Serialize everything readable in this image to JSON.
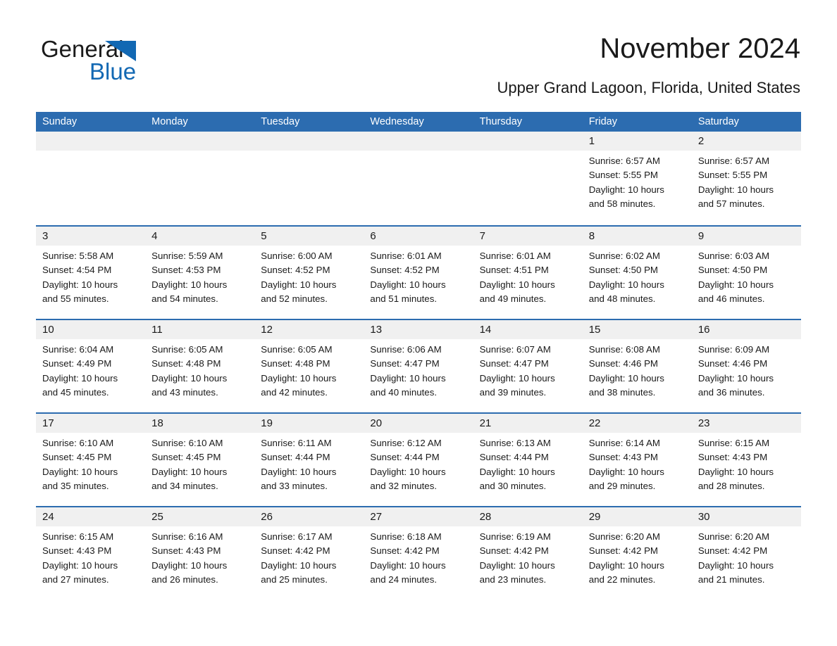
{
  "brand": {
    "name_part1": "General",
    "name_part2": "Blue",
    "triangle_color": "#1268b3",
    "accent_color": "#2c6cb0"
  },
  "header": {
    "title": "November 2024",
    "subtitle": "Upper Grand Lagoon, Florida, United States"
  },
  "calendar": {
    "weekdays": [
      "Sunday",
      "Monday",
      "Tuesday",
      "Wednesday",
      "Thursday",
      "Friday",
      "Saturday"
    ],
    "header_bg": "#2c6cb0",
    "daynum_bg": "#f0f0f0",
    "weeks": [
      [
        {
          "day": "",
          "sunrise": "",
          "sunset": "",
          "daylight1": "",
          "daylight2": ""
        },
        {
          "day": "",
          "sunrise": "",
          "sunset": "",
          "daylight1": "",
          "daylight2": ""
        },
        {
          "day": "",
          "sunrise": "",
          "sunset": "",
          "daylight1": "",
          "daylight2": ""
        },
        {
          "day": "",
          "sunrise": "",
          "sunset": "",
          "daylight1": "",
          "daylight2": ""
        },
        {
          "day": "",
          "sunrise": "",
          "sunset": "",
          "daylight1": "",
          "daylight2": ""
        },
        {
          "day": "1",
          "sunrise": "Sunrise: 6:57 AM",
          "sunset": "Sunset: 5:55 PM",
          "daylight1": "Daylight: 10 hours",
          "daylight2": "and 58 minutes."
        },
        {
          "day": "2",
          "sunrise": "Sunrise: 6:57 AM",
          "sunset": "Sunset: 5:55 PM",
          "daylight1": "Daylight: 10 hours",
          "daylight2": "and 57 minutes."
        }
      ],
      [
        {
          "day": "3",
          "sunrise": "Sunrise: 5:58 AM",
          "sunset": "Sunset: 4:54 PM",
          "daylight1": "Daylight: 10 hours",
          "daylight2": "and 55 minutes."
        },
        {
          "day": "4",
          "sunrise": "Sunrise: 5:59 AM",
          "sunset": "Sunset: 4:53 PM",
          "daylight1": "Daylight: 10 hours",
          "daylight2": "and 54 minutes."
        },
        {
          "day": "5",
          "sunrise": "Sunrise: 6:00 AM",
          "sunset": "Sunset: 4:52 PM",
          "daylight1": "Daylight: 10 hours",
          "daylight2": "and 52 minutes."
        },
        {
          "day": "6",
          "sunrise": "Sunrise: 6:01 AM",
          "sunset": "Sunset: 4:52 PM",
          "daylight1": "Daylight: 10 hours",
          "daylight2": "and 51 minutes."
        },
        {
          "day": "7",
          "sunrise": "Sunrise: 6:01 AM",
          "sunset": "Sunset: 4:51 PM",
          "daylight1": "Daylight: 10 hours",
          "daylight2": "and 49 minutes."
        },
        {
          "day": "8",
          "sunrise": "Sunrise: 6:02 AM",
          "sunset": "Sunset: 4:50 PM",
          "daylight1": "Daylight: 10 hours",
          "daylight2": "and 48 minutes."
        },
        {
          "day": "9",
          "sunrise": "Sunrise: 6:03 AM",
          "sunset": "Sunset: 4:50 PM",
          "daylight1": "Daylight: 10 hours",
          "daylight2": "and 46 minutes."
        }
      ],
      [
        {
          "day": "10",
          "sunrise": "Sunrise: 6:04 AM",
          "sunset": "Sunset: 4:49 PM",
          "daylight1": "Daylight: 10 hours",
          "daylight2": "and 45 minutes."
        },
        {
          "day": "11",
          "sunrise": "Sunrise: 6:05 AM",
          "sunset": "Sunset: 4:48 PM",
          "daylight1": "Daylight: 10 hours",
          "daylight2": "and 43 minutes."
        },
        {
          "day": "12",
          "sunrise": "Sunrise: 6:05 AM",
          "sunset": "Sunset: 4:48 PM",
          "daylight1": "Daylight: 10 hours",
          "daylight2": "and 42 minutes."
        },
        {
          "day": "13",
          "sunrise": "Sunrise: 6:06 AM",
          "sunset": "Sunset: 4:47 PM",
          "daylight1": "Daylight: 10 hours",
          "daylight2": "and 40 minutes."
        },
        {
          "day": "14",
          "sunrise": "Sunrise: 6:07 AM",
          "sunset": "Sunset: 4:47 PM",
          "daylight1": "Daylight: 10 hours",
          "daylight2": "and 39 minutes."
        },
        {
          "day": "15",
          "sunrise": "Sunrise: 6:08 AM",
          "sunset": "Sunset: 4:46 PM",
          "daylight1": "Daylight: 10 hours",
          "daylight2": "and 38 minutes."
        },
        {
          "day": "16",
          "sunrise": "Sunrise: 6:09 AM",
          "sunset": "Sunset: 4:46 PM",
          "daylight1": "Daylight: 10 hours",
          "daylight2": "and 36 minutes."
        }
      ],
      [
        {
          "day": "17",
          "sunrise": "Sunrise: 6:10 AM",
          "sunset": "Sunset: 4:45 PM",
          "daylight1": "Daylight: 10 hours",
          "daylight2": "and 35 minutes."
        },
        {
          "day": "18",
          "sunrise": "Sunrise: 6:10 AM",
          "sunset": "Sunset: 4:45 PM",
          "daylight1": "Daylight: 10 hours",
          "daylight2": "and 34 minutes."
        },
        {
          "day": "19",
          "sunrise": "Sunrise: 6:11 AM",
          "sunset": "Sunset: 4:44 PM",
          "daylight1": "Daylight: 10 hours",
          "daylight2": "and 33 minutes."
        },
        {
          "day": "20",
          "sunrise": "Sunrise: 6:12 AM",
          "sunset": "Sunset: 4:44 PM",
          "daylight1": "Daylight: 10 hours",
          "daylight2": "and 32 minutes."
        },
        {
          "day": "21",
          "sunrise": "Sunrise: 6:13 AM",
          "sunset": "Sunset: 4:44 PM",
          "daylight1": "Daylight: 10 hours",
          "daylight2": "and 30 minutes."
        },
        {
          "day": "22",
          "sunrise": "Sunrise: 6:14 AM",
          "sunset": "Sunset: 4:43 PM",
          "daylight1": "Daylight: 10 hours",
          "daylight2": "and 29 minutes."
        },
        {
          "day": "23",
          "sunrise": "Sunrise: 6:15 AM",
          "sunset": "Sunset: 4:43 PM",
          "daylight1": "Daylight: 10 hours",
          "daylight2": "and 28 minutes."
        }
      ],
      [
        {
          "day": "24",
          "sunrise": "Sunrise: 6:15 AM",
          "sunset": "Sunset: 4:43 PM",
          "daylight1": "Daylight: 10 hours",
          "daylight2": "and 27 minutes."
        },
        {
          "day": "25",
          "sunrise": "Sunrise: 6:16 AM",
          "sunset": "Sunset: 4:43 PM",
          "daylight1": "Daylight: 10 hours",
          "daylight2": "and 26 minutes."
        },
        {
          "day": "26",
          "sunrise": "Sunrise: 6:17 AM",
          "sunset": "Sunset: 4:42 PM",
          "daylight1": "Daylight: 10 hours",
          "daylight2": "and 25 minutes."
        },
        {
          "day": "27",
          "sunrise": "Sunrise: 6:18 AM",
          "sunset": "Sunset: 4:42 PM",
          "daylight1": "Daylight: 10 hours",
          "daylight2": "and 24 minutes."
        },
        {
          "day": "28",
          "sunrise": "Sunrise: 6:19 AM",
          "sunset": "Sunset: 4:42 PM",
          "daylight1": "Daylight: 10 hours",
          "daylight2": "and 23 minutes."
        },
        {
          "day": "29",
          "sunrise": "Sunrise: 6:20 AM",
          "sunset": "Sunset: 4:42 PM",
          "daylight1": "Daylight: 10 hours",
          "daylight2": "and 22 minutes."
        },
        {
          "day": "30",
          "sunrise": "Sunrise: 6:20 AM",
          "sunset": "Sunset: 4:42 PM",
          "daylight1": "Daylight: 10 hours",
          "daylight2": "and 21 minutes."
        }
      ]
    ]
  }
}
